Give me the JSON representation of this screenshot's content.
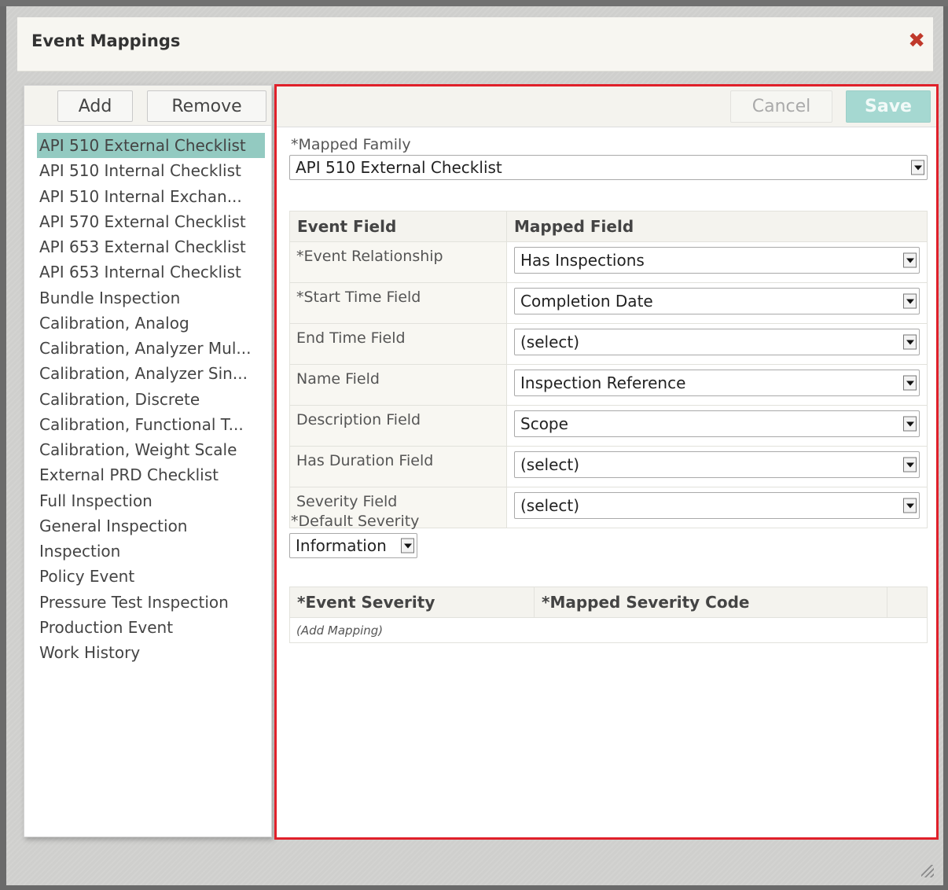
{
  "dialog": {
    "title": "Event Mappings",
    "close_icon": "close-icon"
  },
  "families": {
    "add_label": "Add",
    "remove_label": "Remove",
    "selected_index": 0,
    "items": [
      "API 510 External Checklist",
      "API 510 Internal Checklist",
      "API 510 Internal Exchan...",
      "API 570 External Checklist",
      "API 653 External Checklist",
      "API 653 Internal Checklist",
      "Bundle Inspection",
      "Calibration, Analog",
      "Calibration, Analyzer Mul...",
      "Calibration, Analyzer Sin...",
      "Calibration, Discrete",
      "Calibration, Functional T...",
      "Calibration, Weight Scale",
      "External PRD Checklist",
      "Full Inspection",
      "General Inspection",
      "Inspection",
      "Policy Event",
      "Pressure Test Inspection",
      "Production Event",
      "Work History"
    ]
  },
  "editor": {
    "cancel_label": "Cancel",
    "save_label": "Save",
    "mapped_family_label": "*Mapped Family",
    "mapped_family_value": "API 510 External Checklist",
    "table": {
      "col_event_field": "Event Field",
      "col_mapped_field": "Mapped Field",
      "rows": [
        {
          "field": "*Event Relationship",
          "mapped": "Has Inspections"
        },
        {
          "field": "*Start Time Field",
          "mapped": "Completion Date"
        },
        {
          "field": "End Time Field",
          "mapped": "(select)"
        },
        {
          "field": "Name Field",
          "mapped": "Inspection Reference"
        },
        {
          "field": "Description Field",
          "mapped": "Scope"
        },
        {
          "field": "Has Duration Field",
          "mapped": "(select)"
        },
        {
          "field": "Severity Field",
          "mapped": "(select)"
        }
      ]
    },
    "default_severity_label": "*Default Severity",
    "default_severity_value": "Information",
    "severity_table": {
      "col_event_severity": "*Event Severity",
      "col_mapped_code": "*Mapped Severity Code",
      "add_mapping": "(Add Mapping)"
    }
  },
  "colors": {
    "selected_row": "#93cac1",
    "highlight_border": "#e0202a",
    "save_button": "#a5d8d1",
    "close_icon": "#c0392b"
  }
}
